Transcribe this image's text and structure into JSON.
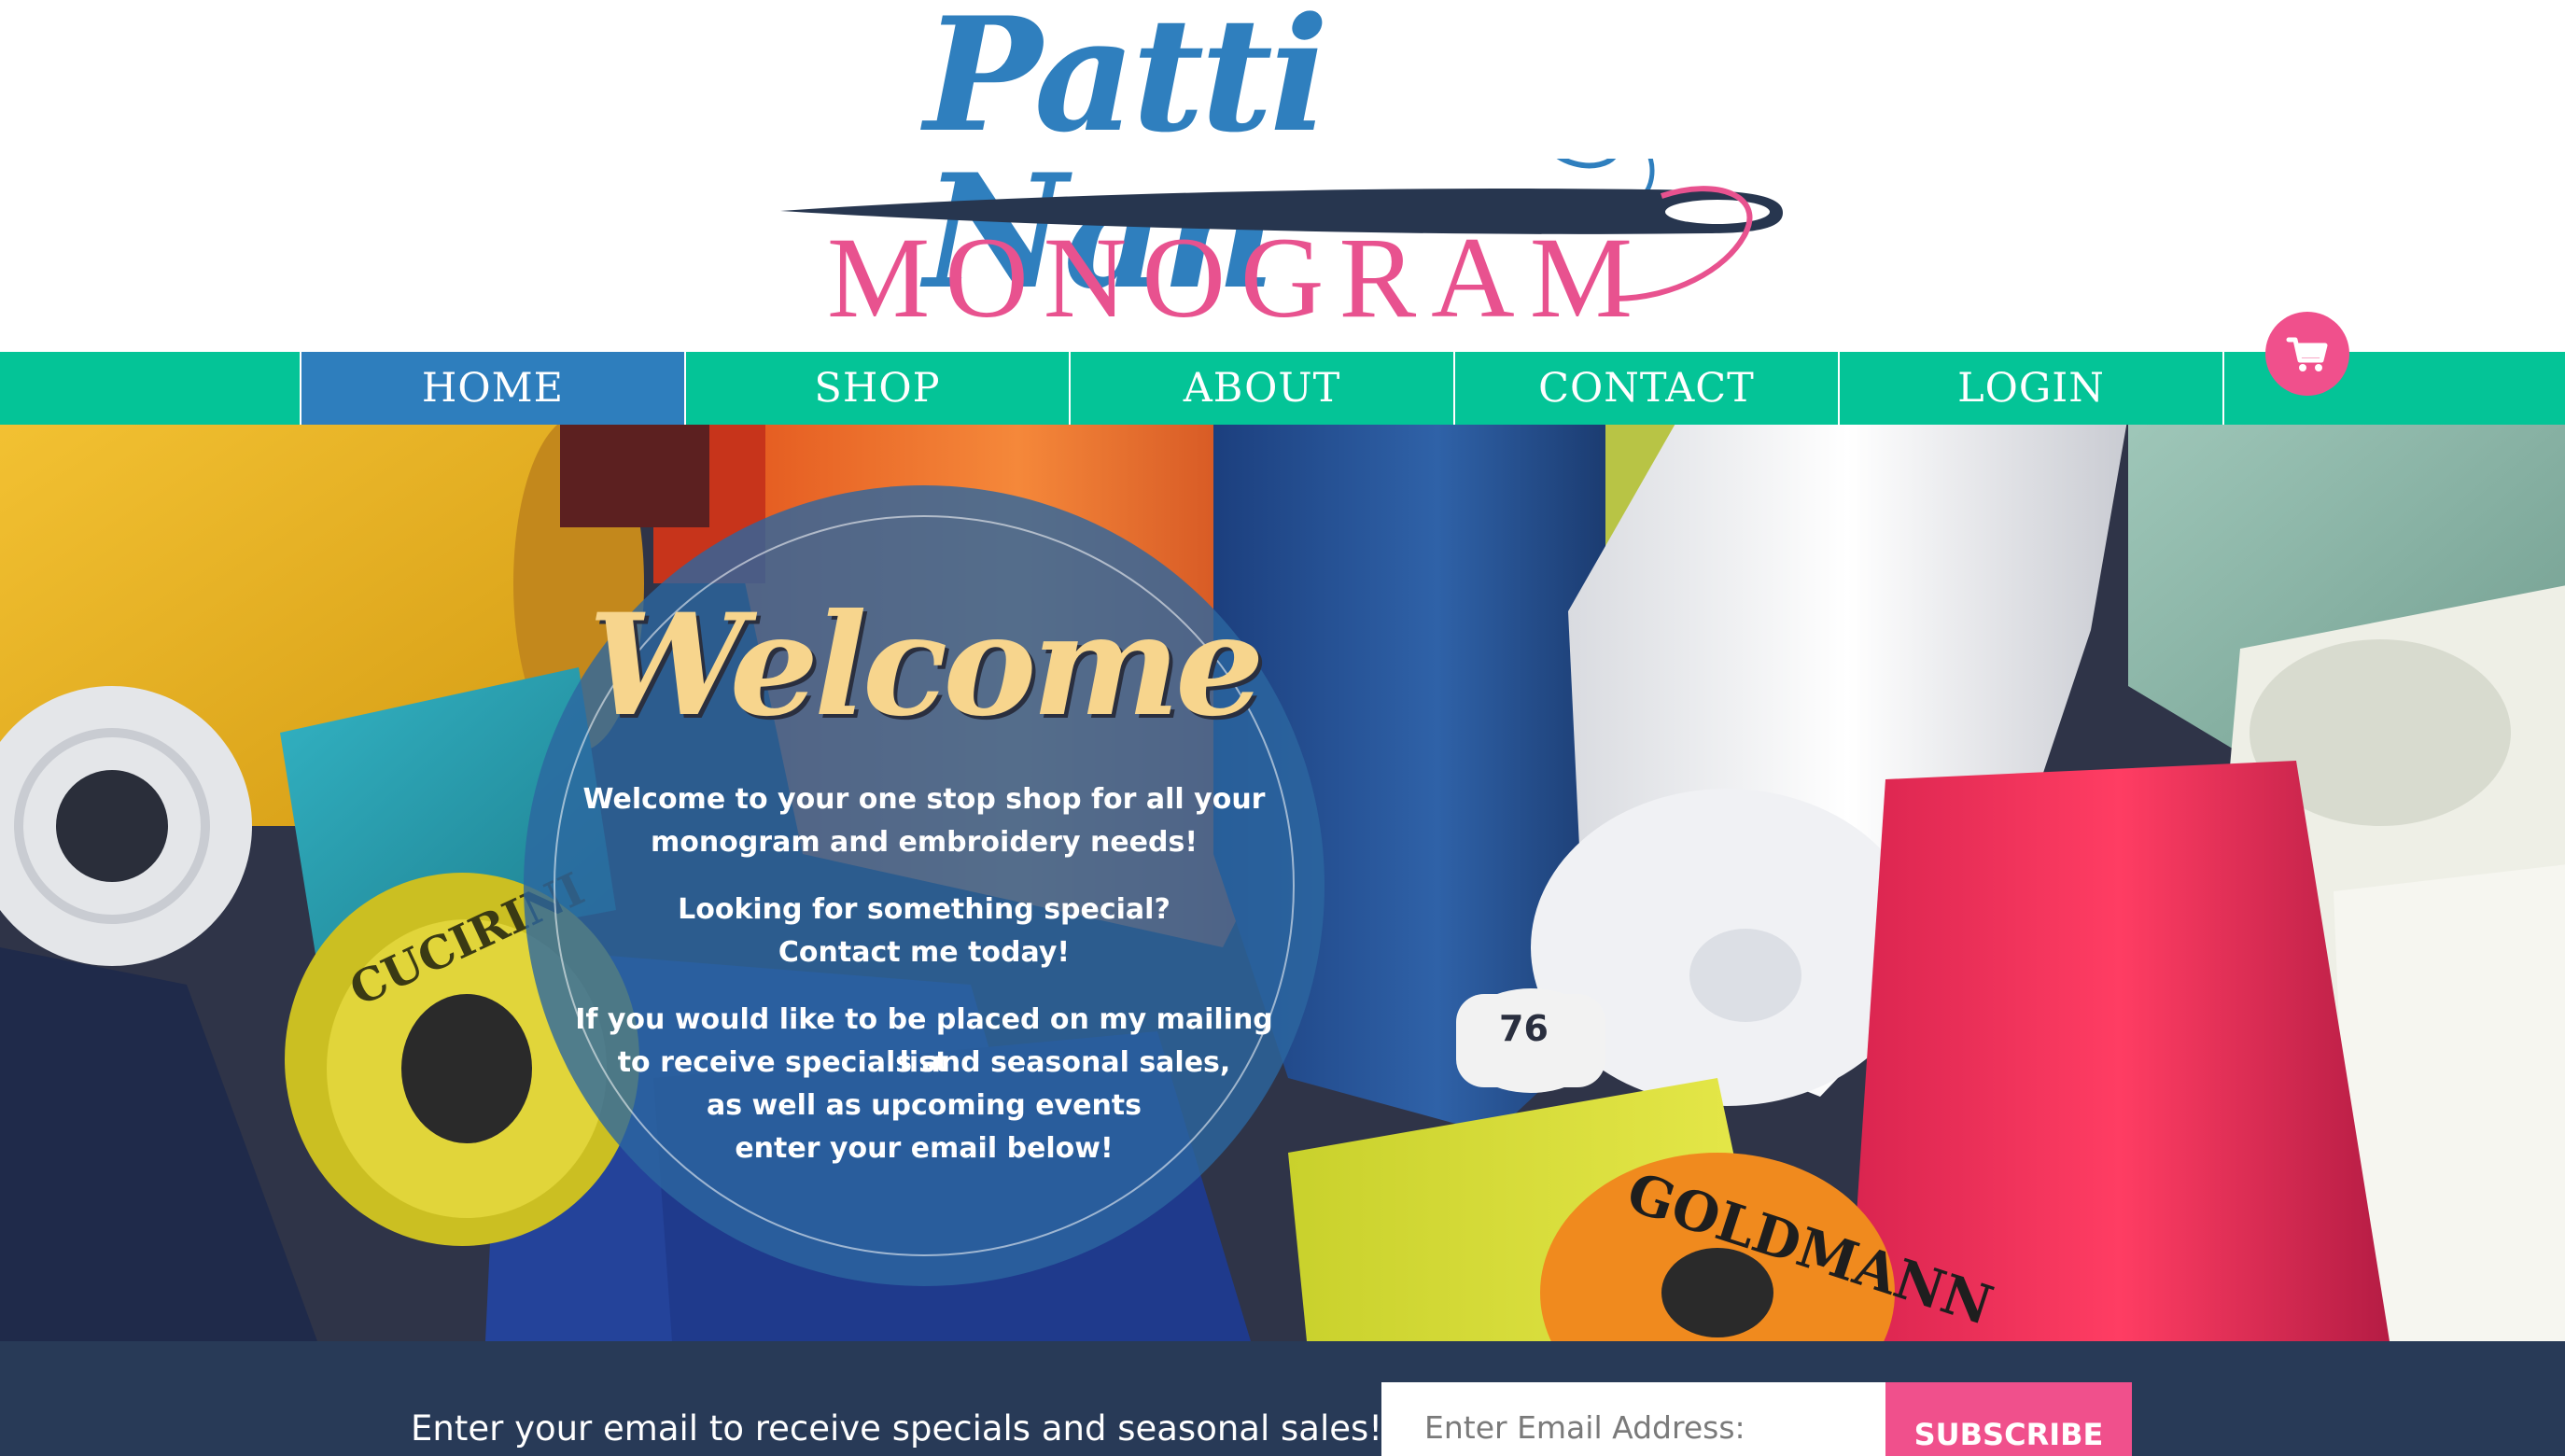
{
  "logo": {
    "title": "Patti Nan",
    "subtitle": "MONOGRAM"
  },
  "nav": {
    "items": [
      {
        "label": "HOME",
        "active": true
      },
      {
        "label": "SHOP",
        "active": false
      },
      {
        "label": "ABOUT",
        "active": false
      },
      {
        "label": "CONTACT",
        "active": false
      },
      {
        "label": "LOGIN",
        "active": false
      }
    ],
    "cart_icon": "shopping-cart-icon"
  },
  "hero": {
    "heading": "Welcome",
    "paragraph_1_line_1": "Welcome to your one stop shop for all your",
    "paragraph_1_line_2": "monogram and embroidery needs!",
    "paragraph_2_line_1": "Looking for something special?",
    "paragraph_2_line_2": "Contact me today!",
    "paragraph_3_line_1": "If you would like to be placed on my mailing list",
    "paragraph_3_line_2": "to receive specials and seasonal sales,",
    "paragraph_3_line_3": "as well as upcoming events",
    "paragraph_3_line_4": "enter your email below!",
    "spool_label": "76",
    "spool_brand_1": "CUCIRINI",
    "spool_brand_2": "GOLDMANN"
  },
  "signup": {
    "prompt": "Enter your email to receive specials and seasonal sales!",
    "email_placeholder": "Enter Email Address:",
    "email_value": "",
    "subscribe_label": "SUBSCRIBE"
  },
  "colors": {
    "nav_green": "#04c497",
    "nav_active_blue": "#2e7ebd",
    "brand_pink": "#f0508c",
    "logo_blue": "#2f7fbe",
    "footer_navy": "#283a57",
    "welcome_gold": "#f7d58d"
  }
}
